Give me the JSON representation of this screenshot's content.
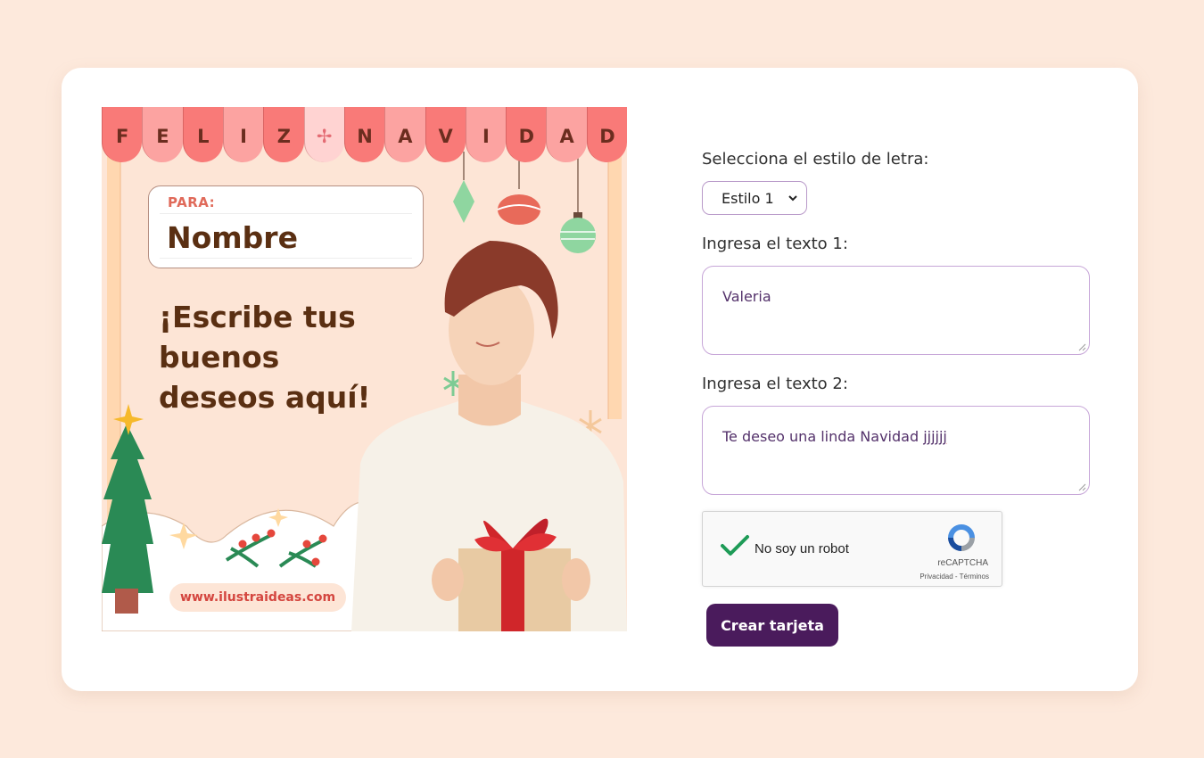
{
  "card": {
    "banner_letters": [
      "F",
      "E",
      "L",
      "I",
      "Z",
      "✢",
      "N",
      "A",
      "V",
      "I",
      "D",
      "A",
      "D"
    ],
    "para_label": "PARA:",
    "name_placeholder": "Nombre",
    "wishes_text": "¡Escribe tus buenos deseos aquí!",
    "website": "www.ilustraideas.com"
  },
  "form": {
    "font_style_label": "Selecciona el estilo de letra:",
    "font_style_value": "Estilo 1",
    "text1_label": "Ingresa el texto 1:",
    "text1_value": "Valeria",
    "text2_label": "Ingresa el texto 2:",
    "text2_value_main": "Te deseo una linda Navidad ",
    "text2_value_flagged": "jjjjjj",
    "captcha_label": "No soy un robot",
    "captcha_brand": "reCAPTCHA",
    "captcha_terms": "Privacidad - Términos",
    "submit_label": "Crear tarjeta"
  },
  "colors": {
    "page_bg": "#fde9dc",
    "accent": "#4a1b5c",
    "field_border": "#c7a6d8",
    "check_green": "#1e9b57"
  }
}
